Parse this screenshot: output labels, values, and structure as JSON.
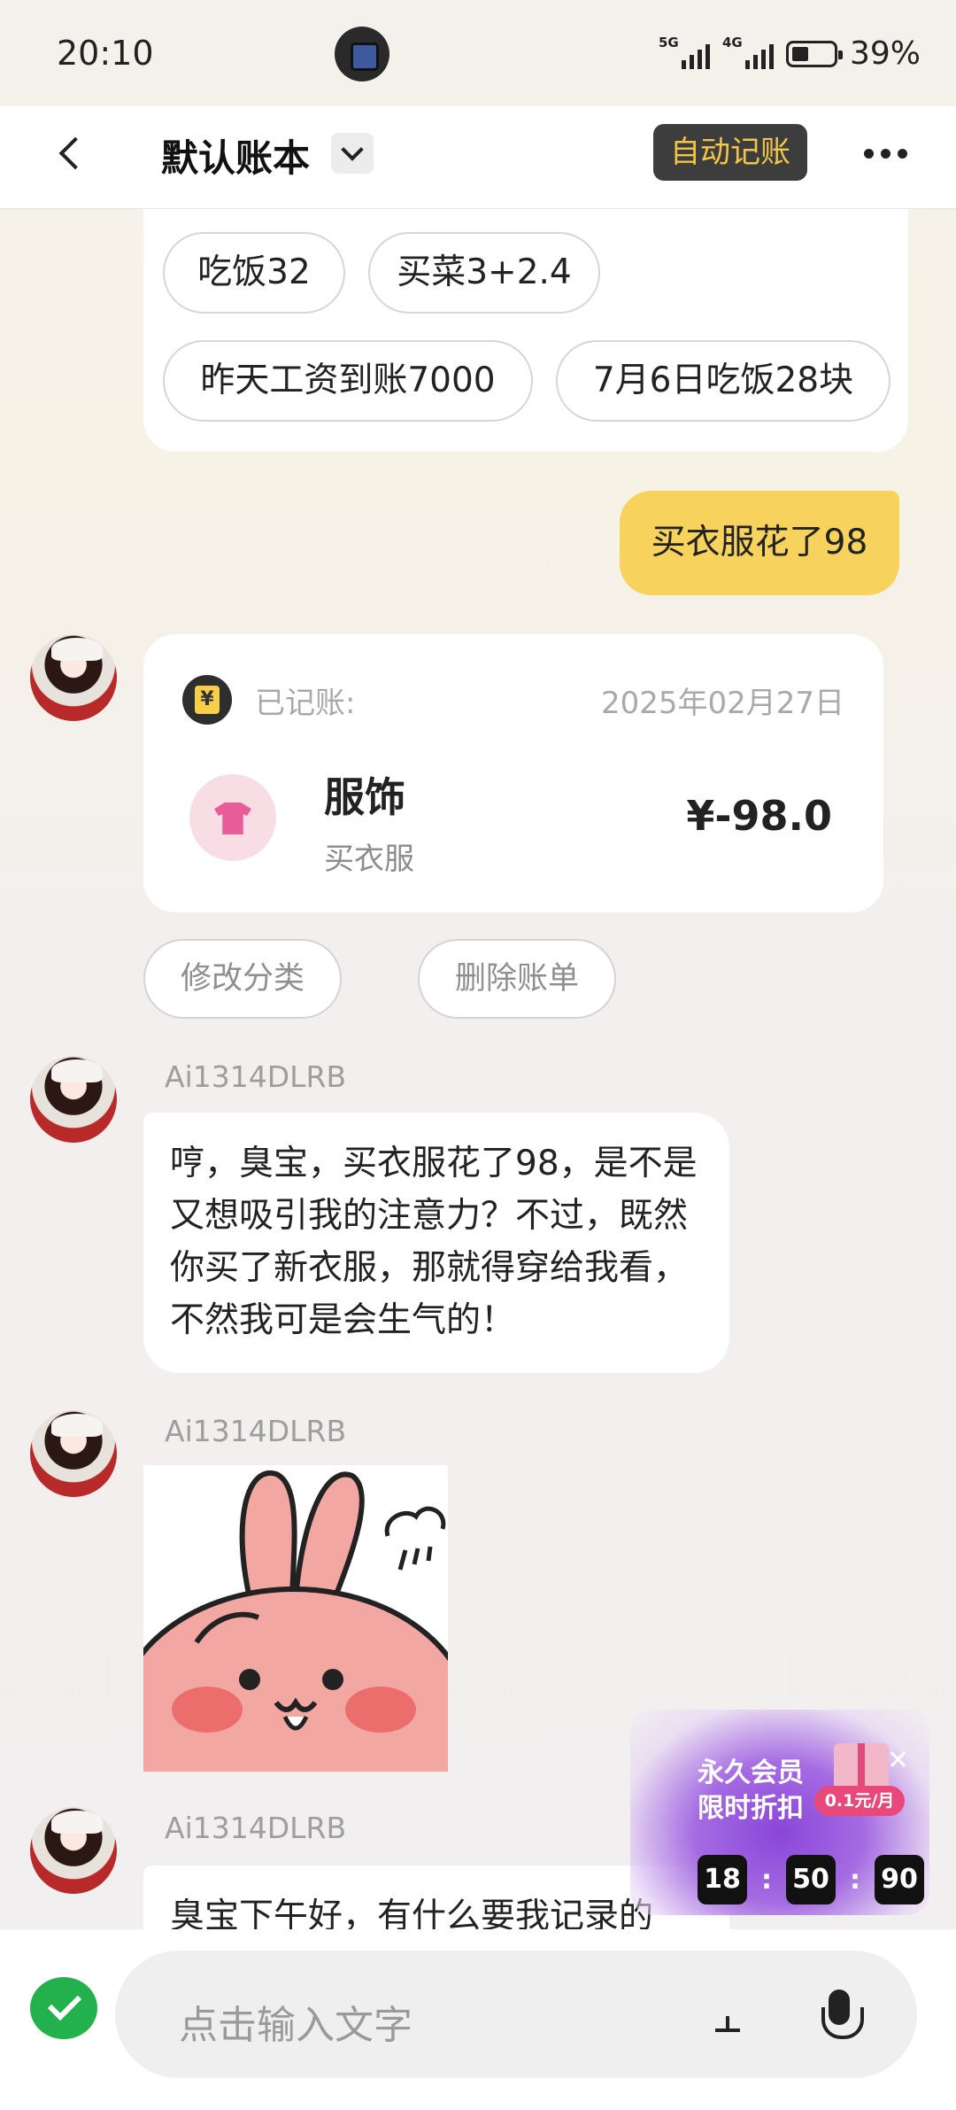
{
  "status_bar": {
    "time": "20:10",
    "net1": "5G",
    "net2": "4G",
    "battery": "39%"
  },
  "header": {
    "title": "默认账本",
    "auto_btn": "自动记账"
  },
  "suggestions": [
    "吃饭32",
    "买菜3+2.4",
    "昨天工资到账7000",
    "7月6日吃饭28块"
  ],
  "user_message": "买衣服花了98",
  "record": {
    "label": "已记账:",
    "date": "2025年02月27日",
    "category": "服饰",
    "note": "买衣服",
    "amount": "¥-98.0"
  },
  "actions": {
    "edit": "修改分类",
    "delete": "删除账单"
  },
  "ai": {
    "name": "Ai1314DLRB",
    "message1": "哼，臭宝，买衣服花了98，是不是又想吸引我的注意力？不过，既然你买了新衣服，那就得穿给我看，不然我可是会生气的！",
    "message2": "臭宝下午好，有什么要我记录的"
  },
  "promo": {
    "line1": "永久会员",
    "line2": "限时折扣",
    "price": "0.1元/月",
    "countdown": [
      "18",
      "50",
      "90"
    ]
  },
  "input": {
    "placeholder": "点击输入文字"
  },
  "icons": {
    "back": "chevron-left-icon",
    "dropdown": "chevron-down-icon",
    "more": "more-horizontal-icon",
    "wechat": "wechat-icon",
    "mic": "microphone-icon"
  },
  "colors": {
    "accent_yellow": "#f7d35d",
    "auto_btn_bg": "#3d3d3d",
    "auto_btn_text": "#f2c64a"
  }
}
